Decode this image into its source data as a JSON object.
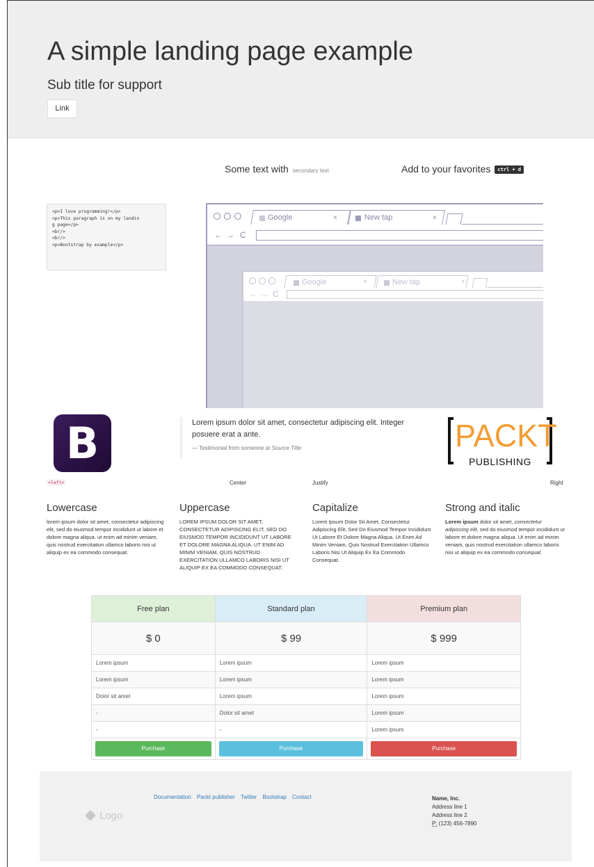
{
  "jumbotron": {
    "title": "A simple landing page example",
    "subtitle": "Sub title for support",
    "link_label": "Link"
  },
  "intro": {
    "text": "Some text with",
    "secondary": "secondary text",
    "favorites_text": "Add to your favorites",
    "shortcut": "ctrl + d"
  },
  "code_lines": [
    "<p>I love programming!</p>",
    "<p>This paragraph is on my landin",
    "g page</p>",
    "<br/>",
    "<br/>",
    "<p>Bootstrap by example</p>"
  ],
  "browser": {
    "tab1": "Google",
    "tab2": "New tap",
    "close_glyph": "×",
    "back_glyph": "←",
    "forward_glyph": "→",
    "reload_glyph": "C"
  },
  "brand_logo_letter": "B",
  "testimonial": {
    "text": "Lorem ipsum dolor sit amet, consectetur adipiscing elit. Integer posuere erat a ante.",
    "source_prefix": "— Testimonial from someone at",
    "source_title": "Source Title"
  },
  "packt": {
    "word": "PACKT",
    "publishing": "PUBLISHING"
  },
  "alignments": {
    "left": "<left>",
    "center": "Center",
    "justify": "Justify",
    "right": "Right"
  },
  "columns": [
    {
      "title": "Lowercase",
      "text": "Lorem ipsum dolor sit amet, consectetur adipiscing elit, sed do eiusmod tempor incididunt ut labore et dolore magna aliqua. Ut enim ad minim veniam, quis nostrud exercitation ullamco laboris nisi ut aliquip ex ea commodo consequat."
    },
    {
      "title": "Uppercase",
      "text": "Lorem ipsum dolor sit amet, consectetur adipiscing elit, sed do eiusmod tempor incididunt ut labore et dolore magna aliqua. Ut enim ad minim veniam, quis nostrud exercitation ullamco laboris nisi ut aliquip ex ea commodo consequat."
    },
    {
      "title": "Capitalize",
      "text": "Lorem ipsum dolor sit amet, consectetur adipiscing elit, sed do eiusmod tempor incididunt ut labore et dolore magna aliqua. Ut enim ad minim veniam, quis nostrud exercitation ullamco laboris nisi ut aliquip ex ea commodo consequat."
    },
    {
      "title": "Strong and italic",
      "strong": "Lorem ipsum",
      "text_mid": " dolor sit amet, ",
      "italic1": "consectetur adipiscing elit",
      "text_rest": ", sed do eiusmod tempor incididunt ut labore et dolore magna aliqua. Ut enim ad minim veniam, quis nostrud exercitation ullamco laboris nisi ut aliquip ex ea commodo ",
      "italic2": "consequat",
      "end": "."
    }
  ],
  "pricing": {
    "plans": [
      "Free plan",
      "Standard plan",
      "Premium plan"
    ],
    "prices": [
      "$ 0",
      "$ 99",
      "$ 999"
    ],
    "rows": [
      [
        "Lorem ipsum",
        "Lorem ipsum",
        "Lorem ipsum"
      ],
      [
        "Lorem ipsum",
        "Lorem ipsum",
        "Lorem ipsum"
      ],
      [
        "Dolor sit amet",
        "Lorem ipsum",
        "Lorem ipsum"
      ],
      [
        "-",
        "Dolor sit amet",
        "Lorem ipsum"
      ],
      [
        "-",
        "-",
        "Lorem ipsum"
      ]
    ],
    "button_label": "Purchase",
    "colors": {
      "free": "#5cb85c",
      "standard": "#5bc0de",
      "premium": "#d9534f"
    }
  },
  "footer": {
    "logo_text": "Logo",
    "links": [
      "Documentation",
      "Packt publisher",
      "Twitter",
      "Bootstrap",
      "Contact"
    ],
    "company": "Name, Inc.",
    "address1": "Address line 1",
    "address2": "Address line 2",
    "phone_label": "P:",
    "phone": "(123) 456-7890"
  }
}
